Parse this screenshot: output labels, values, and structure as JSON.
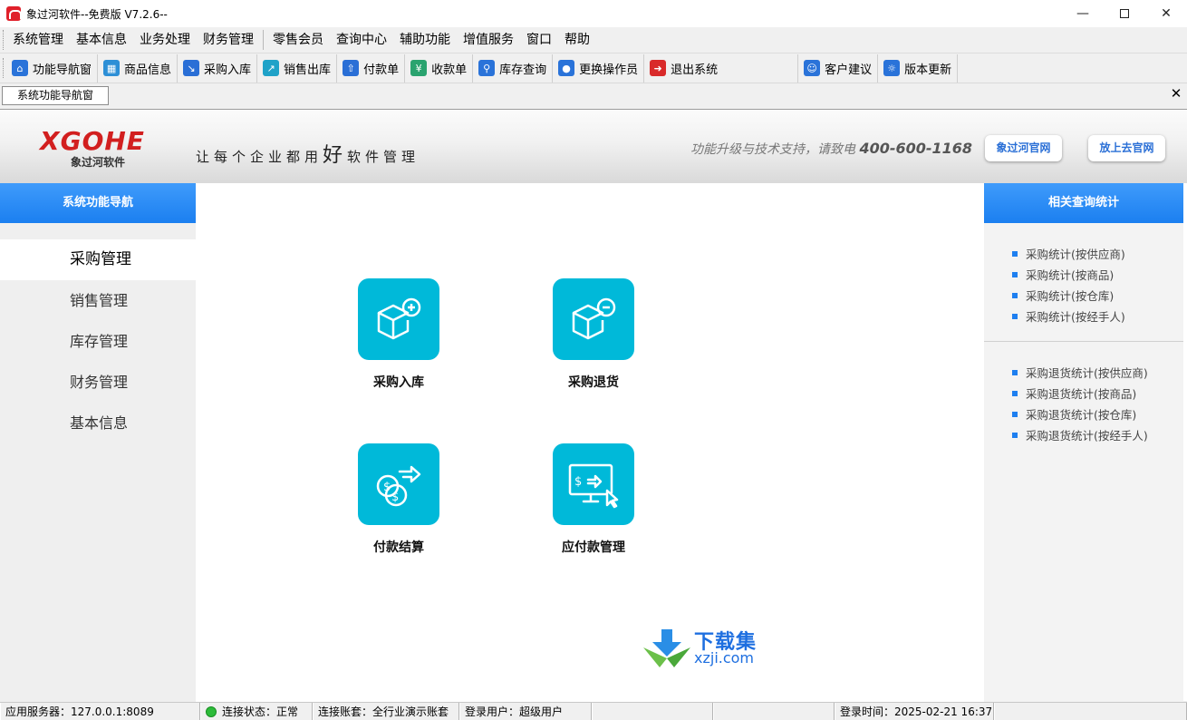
{
  "window": {
    "title": "象过河软件--免费版 V7.2.6--"
  },
  "menu": [
    "系统管理",
    "基本信息",
    "业务处理",
    "财务管理",
    "零售会员",
    "查询中心",
    "辅助功能",
    "增值服务",
    "窗口",
    "帮助"
  ],
  "toolbar": [
    {
      "label": "功能导航窗",
      "icon": "home-icon",
      "color": "#2a73d9"
    },
    {
      "label": "商品信息",
      "icon": "product-info-icon",
      "color": "#2d8fd6"
    },
    {
      "label": "采购入库",
      "icon": "purchase-in-icon",
      "color": "#2a6fd6"
    },
    {
      "label": "销售出库",
      "icon": "sales-out-icon",
      "color": "#1fa2c8"
    },
    {
      "label": "付款单",
      "icon": "payment-icon",
      "color": "#2a6fd6"
    },
    {
      "label": "收款单",
      "icon": "receipt-icon",
      "color": "#2aa36f"
    },
    {
      "label": "库存查询",
      "icon": "stock-search-icon",
      "color": "#2a73d9"
    },
    {
      "label": "更换操作员",
      "icon": "switch-user-icon",
      "color": "#2a73d9"
    },
    {
      "label": "退出系统",
      "icon": "exit-icon",
      "color": "#d92a2a"
    },
    {
      "label": "客户建议",
      "icon": "feedback-icon",
      "color": "#2a73d9"
    },
    {
      "label": "版本更新",
      "icon": "globe-update-icon",
      "color": "#2a73d9"
    }
  ],
  "tab": {
    "label": "系统功能导航窗",
    "close": "✕"
  },
  "banner": {
    "logo": "XGOHE",
    "logo_sub": "象过河软件",
    "slogan_a": "让每个企业都用",
    "slogan_big": "好",
    "slogan_b": "软件管理",
    "hotline_text": "功能升级与技术支持，请致电",
    "hotline_number": "400-600-1168",
    "btn_official": "象过河官网",
    "btn_shangqu": "放上去官网"
  },
  "leftnav": {
    "header": "系统功能导航",
    "items": [
      "采购管理",
      "销售管理",
      "库存管理",
      "财务管理",
      "基本信息"
    ],
    "active": 0
  },
  "functions": [
    "采购入库",
    "采购退货",
    "付款结算",
    "应付款管理"
  ],
  "rightpanel": {
    "header": "相关查询统计",
    "group1": [
      "采购统计(按供应商)",
      "采购统计(按商品)",
      "采购统计(按仓库)",
      "采购统计(按经手人)"
    ],
    "group2": [
      "采购退货统计(按供应商)",
      "采购退货统计(按商品)",
      "采购退货统计(按仓库)",
      "采购退货统计(按经手人)"
    ]
  },
  "watermark": {
    "line1": "下载集",
    "line2": "xzji.com"
  },
  "status": {
    "server": "应用服务器：127.0.0.1:8089",
    "connection": "连接状态：正常",
    "account": "连接账套：全行业演示账套",
    "user": "登录用户：超级用户",
    "login_time": "登录时间：2025-02-21 16:37"
  }
}
